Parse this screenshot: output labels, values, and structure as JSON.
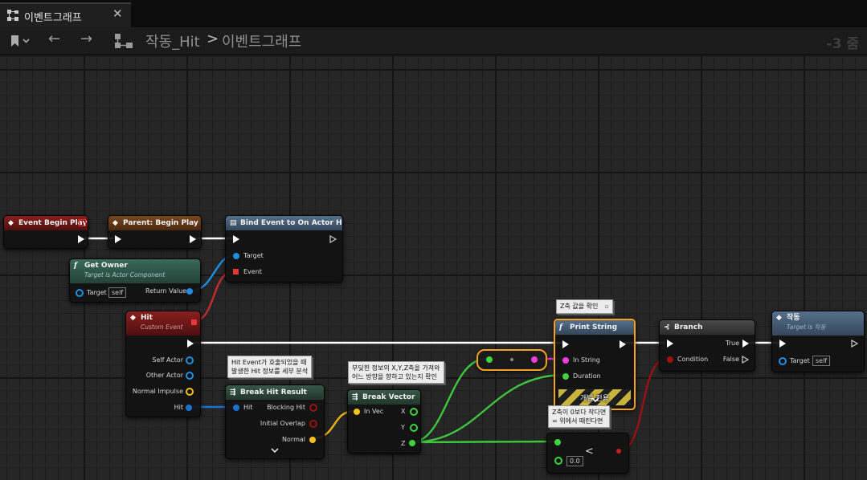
{
  "tab": {
    "title": "이벤트그래프",
    "close": "✕",
    "icon": "graph-icon"
  },
  "toolbar": {
    "back": "←",
    "forward": "→",
    "breadcrumb": [
      "작동_Hit",
      "이벤트그래프"
    ],
    "separator": ">",
    "zoom": "-3 줌"
  },
  "nodes": {
    "event_begin_play": {
      "title": "Event Begin Play"
    },
    "parent_begin_play": {
      "title": "Parent: Begin Play"
    },
    "bind_event": {
      "title": "Bind Event to On Actor Hit",
      "pins": {
        "target": "Target",
        "event": "Event"
      }
    },
    "get_owner": {
      "title": "Get Owner",
      "subtitle": "Target is Actor Component",
      "pins": {
        "target": "Target",
        "target_value": "self",
        "return": "Return Value"
      }
    },
    "hit": {
      "title": "Hit",
      "subtitle": "Custom Event",
      "pins": {
        "self_actor": "Self Actor",
        "other_actor": "Other Actor",
        "normal_impulse": "Normal Impulse",
        "hit": "Hit"
      }
    },
    "break_hit": {
      "title": "Break Hit Result",
      "pins": {
        "hit": "Hit",
        "blocking": "Blocking Hit",
        "overlap": "Initial Overlap",
        "normal": "Normal"
      }
    },
    "break_vector": {
      "title": "Break Vector",
      "pins": {
        "in_vec": "In Vec",
        "x": "X",
        "y": "Y",
        "z": "Z"
      }
    },
    "print_string": {
      "title": "Print String",
      "pins": {
        "in_string": "In String",
        "duration": "Duration"
      },
      "dev_label": "개발 전용"
    },
    "branch": {
      "title": "Branch",
      "pins": {
        "condition": "Condition",
        "true": "True",
        "false": "False"
      }
    },
    "action": {
      "title": "작동",
      "subtitle": "Target is 작동",
      "pins": {
        "target": "Target",
        "target_value": "self"
      }
    },
    "compare": {
      "op": "<",
      "value": "0.0"
    }
  },
  "comments": {
    "hit_event": [
      "Hit Event가 호출되었을 때",
      "발생한 Hit 정보를 세부 분석"
    ],
    "break_vector": [
      "부딪힌 정보의 X,Y,Z축을 가져와",
      "어느 방향을 향하고 있는지 확인"
    ],
    "print_z": [
      "Z축 값을 확인"
    ],
    "compare": [
      "Z축이 0보다 작다면",
      "= 위에서 때린다면"
    ]
  },
  "colors": {
    "event_header": "#7a1a1a",
    "function_header": "#2a5a4f",
    "call_header": "#4b5e75",
    "parent_header": "#6e3e1a",
    "pin_exec": "#ffffff",
    "pin_object": "#1e8fe0",
    "pin_struct": "#1a72cc",
    "pin_delegate": "#e23a3a",
    "pin_vector": "#f5c11a",
    "pin_float": "#3ed43e",
    "pin_string": "#f03ce0",
    "pin_bool": "#9a1212",
    "selection": "#f5a21a"
  }
}
